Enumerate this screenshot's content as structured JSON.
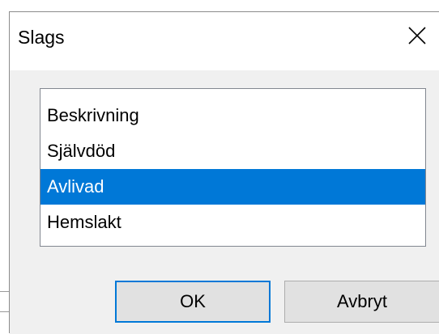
{
  "dialog": {
    "title": "Slags",
    "close_icon": "close-icon"
  },
  "list": {
    "items": [
      {
        "label": "Beskrivning",
        "selected": false
      },
      {
        "label": "Självdöd",
        "selected": false
      },
      {
        "label": "Avlivad",
        "selected": true
      },
      {
        "label": "Hemslakt",
        "selected": false
      }
    ]
  },
  "buttons": {
    "ok_label": "OK",
    "cancel_label": "Avbryt"
  },
  "colors": {
    "selection": "#0078d7",
    "client_bg": "#f0f0f0"
  }
}
